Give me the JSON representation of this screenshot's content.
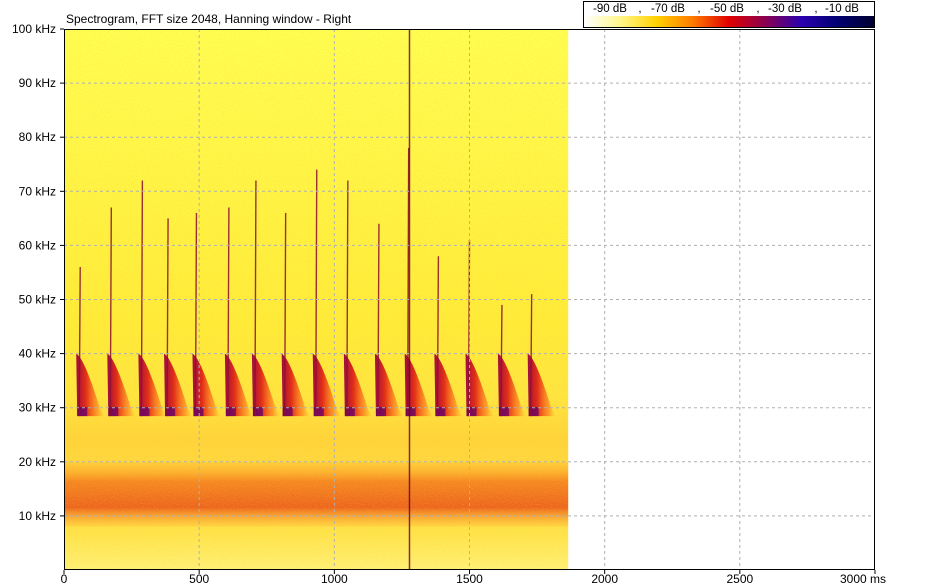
{
  "title": "Spectrogram, FFT size 2048, Hanning window - Right",
  "legend": {
    "labels": [
      "-90 dB",
      "-70 dB",
      "-50 dB",
      "-30 dB",
      "-10 dB"
    ],
    "separators": [
      ",",
      ",",
      ",",
      ","
    ],
    "colors": [
      "#ffffff",
      "#fff68a",
      "#ffd200",
      "#ff7a00",
      "#e00000",
      "#8a0050",
      "#2a00b0",
      "#000070",
      "#000030"
    ]
  },
  "chart_data": {
    "type": "heatmap",
    "title": "Spectrogram, FFT size 2048, Hanning window - Right",
    "x_unit": "ms",
    "y_unit": "kHz",
    "xlim": [
      0,
      3000
    ],
    "ylim": [
      0,
      100
    ],
    "x_ticks": [
      0,
      500,
      1000,
      1500,
      2000,
      2500,
      3000
    ],
    "x_tick_labels": [
      "0",
      "500",
      "1000",
      "1500",
      "2000",
      "2500",
      "3000 ms"
    ],
    "y_ticks": [
      10,
      20,
      30,
      40,
      50,
      60,
      70,
      80,
      90,
      100
    ],
    "y_tick_labels": [
      "10 kHz",
      "20 kHz",
      "30 kHz",
      "40 kHz",
      "50 kHz",
      "60 kHz",
      "70 kHz",
      "80 kHz",
      "90 kHz",
      "100 kHz"
    ],
    "grid": true,
    "signal_end_ms": 1865,
    "colorbar": {
      "min_db": -90,
      "max_db": -10
    },
    "pulses_ms": [
      60,
      175,
      290,
      385,
      490,
      610,
      710,
      820,
      935,
      1050,
      1165,
      1275,
      1385,
      1500,
      1620,
      1730
    ],
    "pulse_peak_khz": [
      56,
      67,
      72,
      65,
      66,
      67,
      72,
      66,
      74,
      72,
      64,
      78,
      58,
      61,
      49,
      51
    ],
    "pulse_base_khz": 29,
    "noise_band_khz": [
      8,
      20
    ]
  }
}
